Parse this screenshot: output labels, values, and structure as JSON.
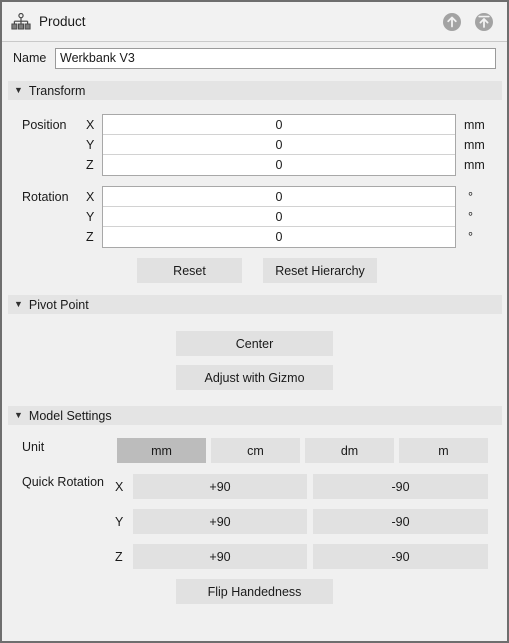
{
  "header": {
    "title": "Product",
    "hierarchy_icon": "hierarchy-icon",
    "action_up_icon": "arrow-up-circle-icon",
    "action_up_top_icon": "arrow-up-to-top-circle-icon"
  },
  "name_row": {
    "label": "Name",
    "value": "Werkbank V3",
    "placeholder": "Name"
  },
  "transform": {
    "section_title": "Transform",
    "collapse_glyph": "▼",
    "position": {
      "label": "Position",
      "axes": [
        "X",
        "Y",
        "Z"
      ],
      "values": [
        "0",
        "0",
        "0"
      ],
      "units": [
        "mm",
        "mm",
        "mm"
      ]
    },
    "rotation": {
      "label": "Rotation",
      "axes": [
        "X",
        "Y",
        "Z"
      ],
      "values": [
        "0",
        "0",
        "0"
      ],
      "units": [
        "°",
        "°",
        "°"
      ]
    },
    "reset_label": "Reset",
    "reset_hierarchy_label": "Reset Hierarchy"
  },
  "pivot": {
    "section_title": "Pivot Point",
    "collapse_glyph": "▼",
    "center_label": "Center",
    "gizmo_label": "Adjust with Gizmo"
  },
  "model_settings": {
    "section_title": "Model Settings",
    "collapse_glyph": "▼",
    "unit_label": "Unit",
    "units": [
      {
        "label": "mm",
        "selected": true
      },
      {
        "label": "cm",
        "selected": false
      },
      {
        "label": "dm",
        "selected": false
      },
      {
        "label": "m",
        "selected": false
      }
    ],
    "quick_rotation_label": "Quick Rotation",
    "quick_rotation_rows": [
      {
        "axis": "X",
        "plus": "+90",
        "minus": "-90"
      },
      {
        "axis": "Y",
        "plus": "+90",
        "minus": "-90"
      },
      {
        "axis": "Z",
        "plus": "+90",
        "minus": "-90"
      }
    ],
    "flip_handedness_label": "Flip Handedness"
  },
  "colors": {
    "panel_background": "#f0f0f0",
    "panel_border": "#6e6e6e",
    "section_bar": "#e4e4e4",
    "button": "#e1e1e1",
    "button_selected": "#bcbcbc",
    "input_border": "#a8a8a8",
    "text": "#1a1a1a"
  }
}
